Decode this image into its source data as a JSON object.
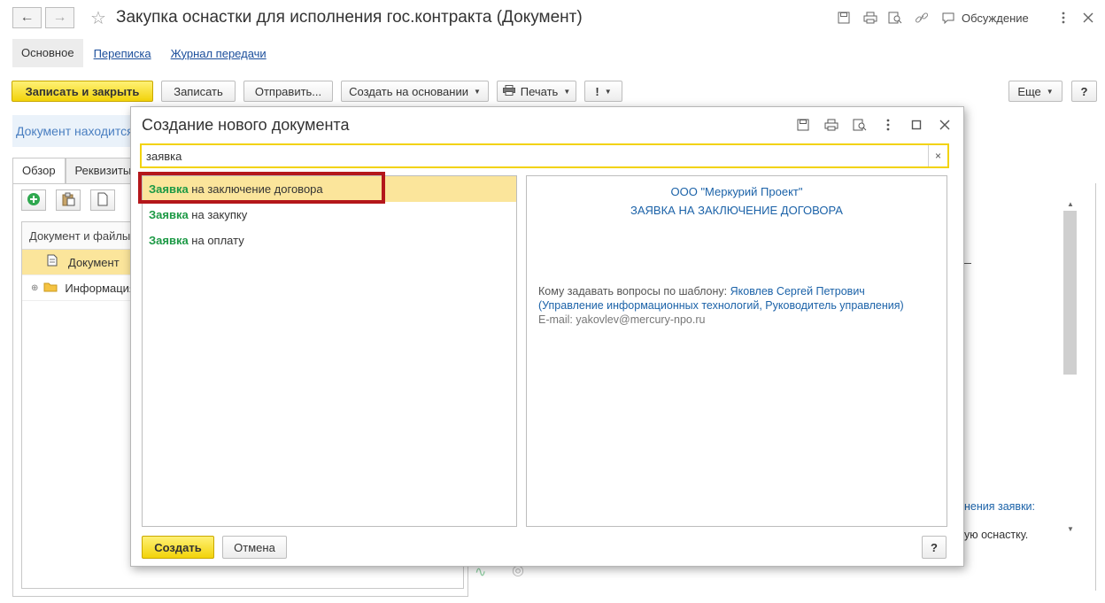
{
  "window": {
    "title": "Закупка оснастки для исполнения гос.контракта (Документ)",
    "discussion_label": "Обсуждение"
  },
  "main_tabs": {
    "basic": "Основное",
    "correspondence": "Переписка",
    "transfer_log": "Журнал передачи"
  },
  "toolbar": {
    "save_close": "Записать и закрыть",
    "save": "Записать",
    "send": "Отправить...",
    "create_based_on": "Создать на основании",
    "print": "Печать",
    "important": "!",
    "more": "Еще",
    "help": "?"
  },
  "document": {
    "status_text": "Документ находится",
    "tab_overview": "Обзор",
    "tab_requisites": "Реквизиты",
    "tree_header": "Документ и файлы",
    "tree_rows": [
      "Документ",
      "Информация"
    ],
    "bg_link_text": "нения заявки:",
    "bg_text": "ую оснастку."
  },
  "dialog": {
    "title": "Создание нового документа",
    "search_value": "заявка",
    "search_clear": "×",
    "items": [
      {
        "highlight": "Заявка",
        "rest": " на заключение договора"
      },
      {
        "highlight": "Заявка",
        "rest": " на закупку"
      },
      {
        "highlight": "Заявка",
        "rest": " на оплату"
      }
    ],
    "preview": {
      "company": "ООО \"Меркурий Проект\"",
      "doc_title": "ЗАЯВКА НА ЗАКЛЮЧЕНИЕ ДОГОВОРА",
      "contact_label": "Кому задавать вопросы по шаблону: ",
      "contact_name": "Яковлев Сергей Петрович",
      "contact_dept": "(Управление информационных технологий, Руководитель управления)",
      "email_label": "E-mail: ",
      "email_value": "yakovlev@mercury-npo.ru"
    },
    "create_button": "Создать",
    "cancel_button": "Отмена",
    "help_button": "?"
  },
  "colors": {
    "accent_yellow": "#f2d30a",
    "selection": "#fbe59b",
    "highlight_green": "#1c9945",
    "frame_red": "#b4171b",
    "link_blue": "#1b62a8"
  }
}
